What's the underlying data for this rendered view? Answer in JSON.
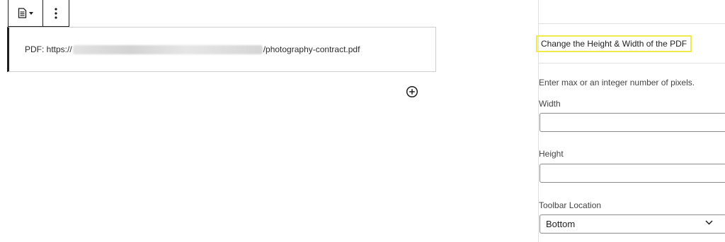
{
  "block": {
    "pdf_prefix": "PDF: https://",
    "pdf_suffix": "/photography-contract.pdf"
  },
  "sidebar": {
    "panel_title": "Change the Height & Width of the PDF",
    "help_text": "Enter max or an integer number of pixels.",
    "width_label": "Width",
    "width_value": "",
    "height_label": "Height",
    "height_value": "",
    "toolbar_location_label": "Toolbar Location",
    "toolbar_location_value": "Bottom"
  },
  "icons": {
    "block_type": "document-icon",
    "more": "more-vertical-icon",
    "add": "plus-circle-icon",
    "chevron": "chevron-down-icon"
  }
}
